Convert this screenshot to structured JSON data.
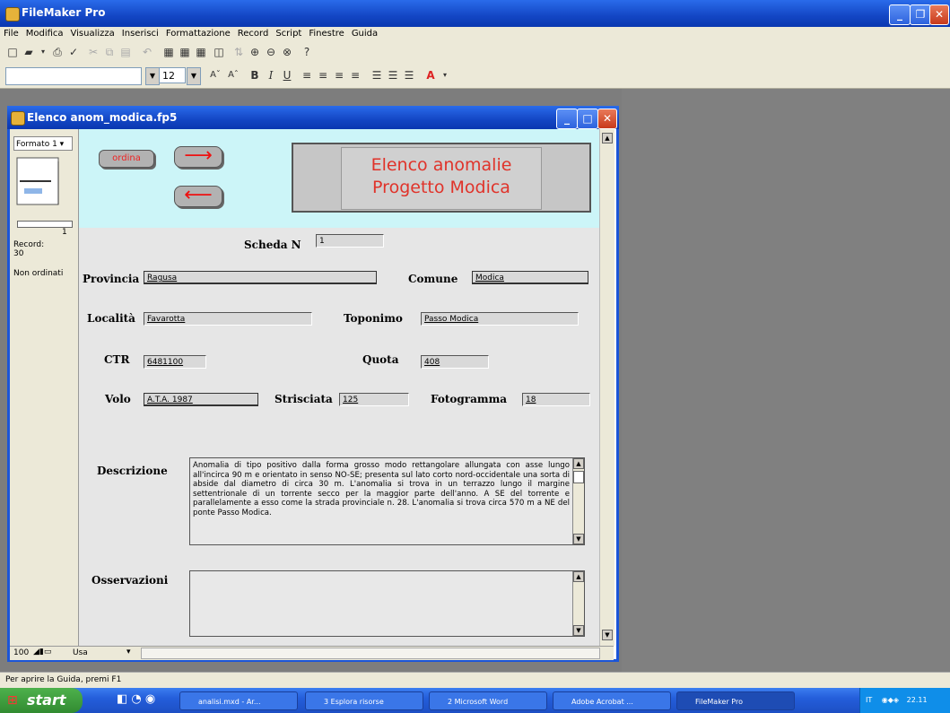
{
  "app": {
    "title": "FileMaker Pro"
  },
  "menu": [
    "File",
    "Modifica",
    "Visualizza",
    "Inserisci",
    "Formattazione",
    "Record",
    "Script",
    "Finestre",
    "Guida"
  ],
  "toolbar": {
    "font_size": "12"
  },
  "document": {
    "title": "Elenco anom_modica.fp5",
    "layout_label": "Formato 1",
    "record_current": "1",
    "record_label": "Record:",
    "record_count": "30",
    "sort_state": "Non ordinati",
    "zoom": "100",
    "mode": "Usa"
  },
  "form": {
    "sort_button": "ordina",
    "next_arrow": "⟶",
    "prev_arrow": "⟵",
    "title_line1": "Elenco anomalie",
    "title_line2": "Progetto Modica",
    "scheda_label": "Scheda N",
    "scheda_value": "1",
    "provincia_label": "Provincia",
    "provincia_value": "Ragusa",
    "comune_label": "Comune",
    "comune_value": "Modica",
    "localita_label": "Località",
    "localita_value": "Favarotta",
    "toponimo_label": "Toponimo",
    "toponimo_value": "Passo Modica",
    "ctr_label": "CTR",
    "ctr_value": "6481100",
    "quota_label": "Quota",
    "quota_value": "408",
    "volo_label": "Volo",
    "volo_value": "A.T.A. 1987",
    "strisciata_label": "Strisciata",
    "strisciata_value": "125",
    "fotogramma_label": "Fotogramma",
    "fotogramma_value": "18",
    "descrizione_label": "Descrizione",
    "descrizione_value": "Anomalia di tipo positivo dalla forma grosso modo rettangolare allungata con asse lungo all'incirca 90 m e orientato in senso NO-SE; presenta sul lato corto nord-occidentale una sorta di abside dal diametro di circa 30 m. L'anomalia si trova in un terrazzo lungo il margine settentrionale di un torrente secco per la maggior parte dell'anno. A SE del torrente e parallelamente a esso come la strada provinciale n. 28. L'anomalia si trova circa 570 m a NE del ponte Passo Modica.",
    "osservazioni_label": "Osservazioni",
    "osservazioni_value": ""
  },
  "statusbar": {
    "text": "Per aprire la Guida, premi F1"
  },
  "taskbar": {
    "start": "start",
    "tasks": [
      "analisi.mxd - Ar...",
      "3 Esplora risorse",
      "2 Microsoft Word",
      "Adobe Acrobat ...",
      "FileMaker Pro"
    ],
    "lang": "IT",
    "clock": "22.11"
  }
}
